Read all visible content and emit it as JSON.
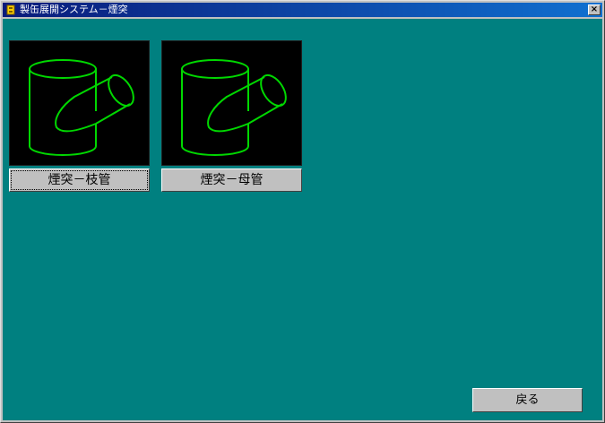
{
  "window": {
    "title": "製缶展開システム－煙突",
    "close_label": "×"
  },
  "items": [
    {
      "label": "煙突－枝管",
      "icon": "pipe-branch-icon",
      "focused": true
    },
    {
      "label": "煙突－母管",
      "icon": "pipe-main-icon",
      "focused": false
    }
  ],
  "footer": {
    "back_label": "戻る"
  },
  "colors": {
    "background": "#008080",
    "drawing": "#00d800",
    "titlebar_start": "#0a1a7a",
    "titlebar_end": "#1070d0"
  }
}
